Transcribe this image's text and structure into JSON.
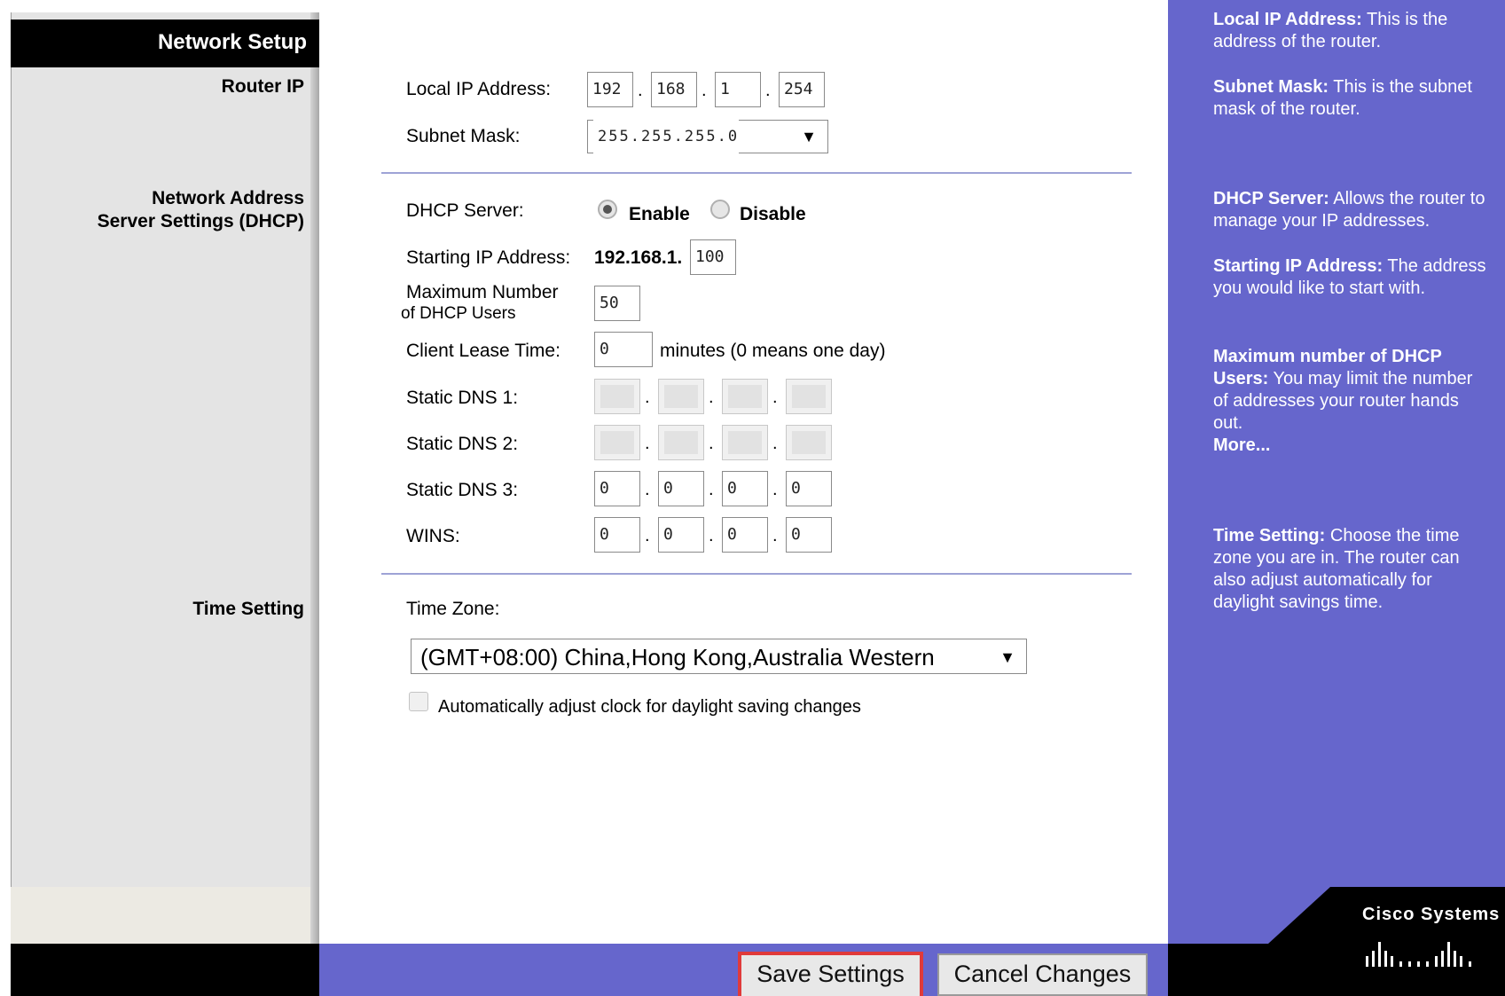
{
  "nav": {
    "title": "Network Setup",
    "sections": {
      "router_ip": "Router IP",
      "dhcp_line1": "Network Address",
      "dhcp_line2": "Server Settings (DHCP)",
      "time": "Time Setting"
    }
  },
  "router_ip": {
    "local_ip_label": "Local IP Address:",
    "local_ip": [
      "192",
      "168",
      "1",
      "254"
    ],
    "subnet_label": "Subnet Mask:",
    "subnet_value": "255.255.255.0"
  },
  "dhcp": {
    "server_label": "DHCP Server:",
    "enable_label": "Enable",
    "disable_label": "Disable",
    "server_state": "Enable",
    "start_ip_label": "Starting IP Address:",
    "start_ip_prefix": "192.168.1.",
    "start_ip_last": "100",
    "max_users_label_line1": "Maximum Number",
    "max_users_label_line2": "of  DHCP Users",
    "max_users": "50",
    "lease_label": "Client Lease Time:",
    "lease_value": "0",
    "lease_note": "minutes (0 means one day)",
    "dns1_label": "Static DNS 1:",
    "dns2_label": "Static DNS 2:",
    "dns3_label": "Static DNS 3:",
    "dns3": [
      "0",
      "0",
      "0",
      "0"
    ],
    "wins_label": "WINS:",
    "wins": [
      "0",
      "0",
      "0",
      "0"
    ]
  },
  "time": {
    "zone_label": "Time Zone:",
    "zone_value": "(GMT+08:00) China,Hong Kong,Australia Western",
    "dst_label": "Automatically adjust clock for daylight saving changes",
    "dst_checked": false
  },
  "help": {
    "local_ip_title": "Local IP Address:",
    "local_ip_text": "This is the address of the router.",
    "subnet_title": "Subnet Mask:",
    "subnet_text": "This is the subnet mask of the router.",
    "dhcp_title": "DHCP Server:",
    "dhcp_text": "Allows the router to manage your IP addresses.",
    "start_title": "Starting IP Address:",
    "start_text": "The address you would like to start with.",
    "max_title": "Maximum number of DHCP Users:",
    "max_text": "You may limit the number of addresses your router hands out.",
    "more": "More...",
    "time_title": "Time Setting:",
    "time_text": "Choose the time zone you are in. The router can also adjust automatically for daylight savings time."
  },
  "footer": {
    "save_label": "Save Settings",
    "cancel_label": "Cancel Changes",
    "brand": "Cisco Systems"
  },
  "colors": {
    "help_bg": "#6666cc",
    "highlight": "#e03a3a"
  }
}
